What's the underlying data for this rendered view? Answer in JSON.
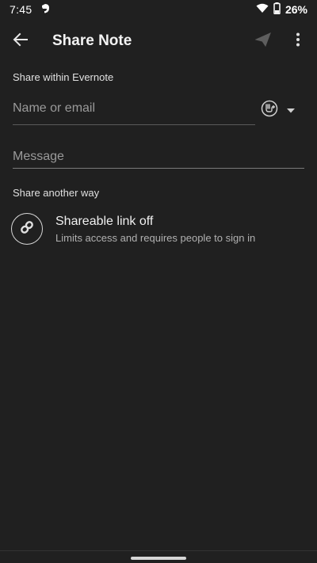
{
  "status_bar": {
    "time": "7:45",
    "battery": "26%",
    "icons": [
      "evernote-icon",
      "wifi-icon",
      "battery-icon"
    ]
  },
  "app_bar": {
    "title": "Share Note",
    "icons": [
      "back-arrow-icon",
      "send-icon",
      "more-vert-icon"
    ]
  },
  "share_within": {
    "label": "Share within Evernote",
    "name_placeholder": "Name or email",
    "message_placeholder": "Message",
    "icons": [
      "permission-icon",
      "dropdown-icon"
    ]
  },
  "share_another": {
    "label": "Share another way",
    "link_title": "Shareable link off",
    "link_subtitle": "Limits access and requires people to sign in",
    "icon": "link-icon"
  },
  "colors": {
    "background": "#202020",
    "text_primary": "#e8e8e8",
    "text_secondary": "#9a9a9a",
    "divider": "#5a5a5a"
  }
}
